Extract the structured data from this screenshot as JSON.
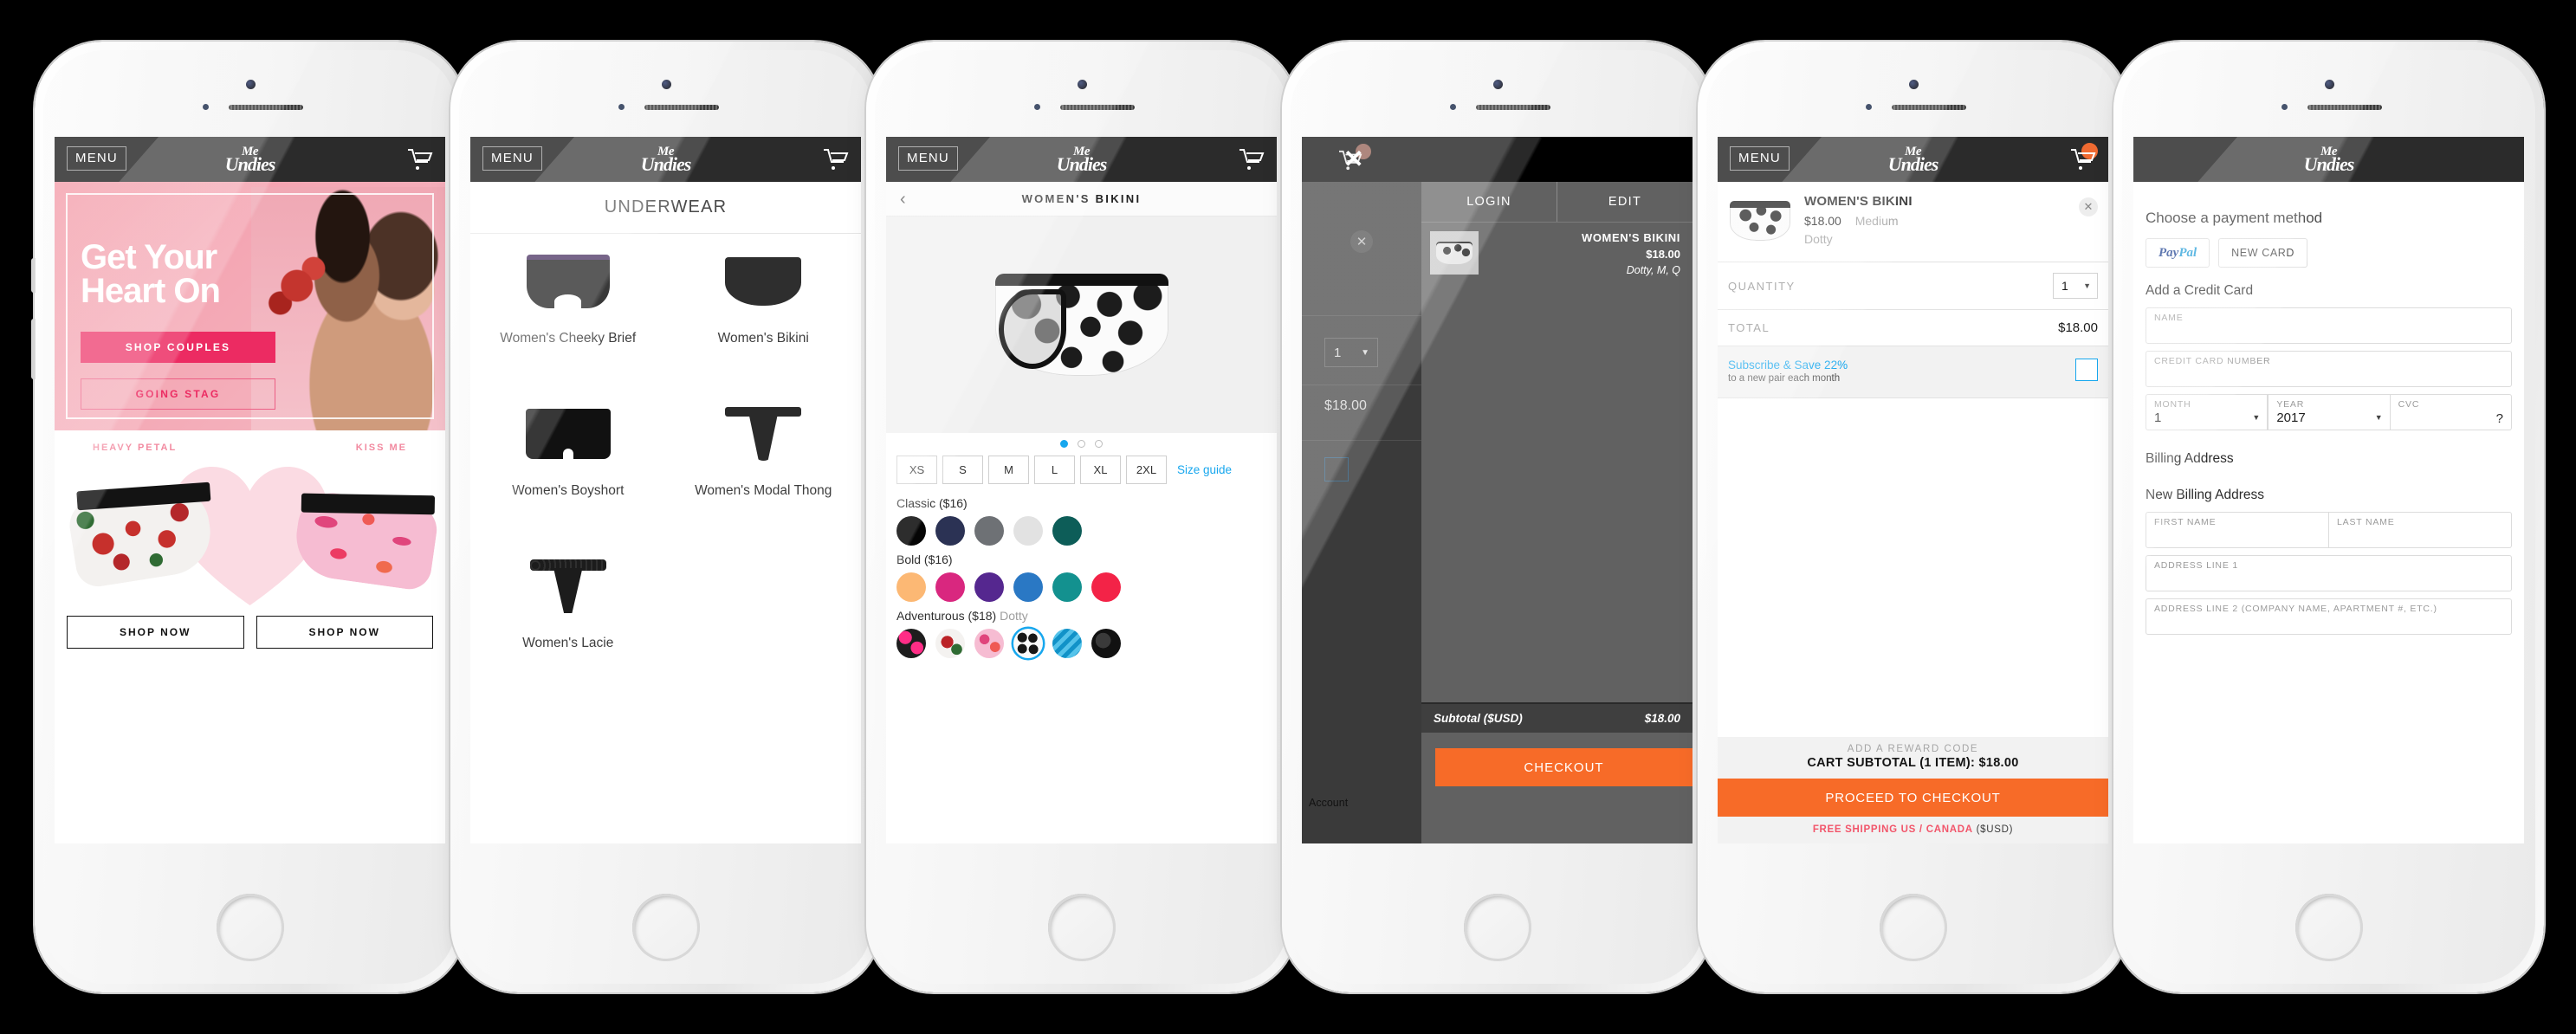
{
  "brand": {
    "logo_line1": "Me",
    "logo_line2": "Undies"
  },
  "common": {
    "menu_label": "MENU",
    "cart_icon": "shopping-cart-icon"
  },
  "screens": [
    {
      "id": "home",
      "hero": {
        "headline_line1": "Get Your",
        "headline_line2": "Heart On",
        "primary_button": "SHOP COUPLES",
        "secondary_button": "GOING STAG"
      },
      "promo": {
        "left_label": "HEAVY PETAL",
        "right_label": "KISS ME",
        "left_button": "SHOP NOW",
        "right_button": "SHOP NOW"
      }
    },
    {
      "id": "category",
      "title": "UNDERWEAR",
      "products": [
        {
          "name": "Women's Cheeky Brief",
          "art": "cheeky-brief"
        },
        {
          "name": "Women's Bikini",
          "art": "bikini"
        },
        {
          "name": "Women's Boyshort",
          "art": "boyshort"
        },
        {
          "name": "Women's Modal Thong",
          "art": "thong"
        },
        {
          "name": "Women's Lacie",
          "art": "lacie"
        }
      ]
    },
    {
      "id": "product",
      "title": "WOMEN'S BIKINI",
      "back_icon": "chevron-left-icon",
      "carousel": {
        "total": 3,
        "active": 1
      },
      "sizes": [
        "XS",
        "S",
        "M",
        "L",
        "XL",
        "2XL"
      ],
      "size_guide": "Size guide",
      "color_groups": [
        {
          "label": "Classic ($16)",
          "selected_name": "",
          "swatches": [
            "#050505",
            "#2b3254",
            "#6e7175",
            "#e2e2e2",
            "#0d5d58"
          ]
        },
        {
          "label": "Bold ($16)",
          "selected_name": "",
          "swatches": [
            "#fcb874",
            "#d9277f",
            "#55278f",
            "#2a78c4",
            "#13918f",
            "#f32347"
          ]
        },
        {
          "label": "Adventurous ($18)",
          "selected_name": "Dotty",
          "swatches": [
            "#e82a7a",
            "#bb2327",
            "#f3a7c4",
            "#f7f7f7",
            "#1192c8",
            "#1c1c1c"
          ],
          "selected_index": 3
        }
      ]
    },
    {
      "id": "cart-overlay",
      "close_icon": "close-icon",
      "tabs": [
        "LOGIN",
        "EDIT"
      ],
      "item": {
        "name": "WOMEN'S BIKINI",
        "price": "$18.00",
        "variant": "Dotty, M, Q"
      },
      "quantity": "1",
      "line_price": "$18.00",
      "subtotal_label": "Subtotal ($USD)",
      "subtotal_value": "$18.00",
      "checkout_button": "CHECKOUT",
      "account_label": "Account"
    },
    {
      "id": "cart",
      "item": {
        "name": "WOMEN'S BIKINI",
        "price": "$18.00",
        "size": "Medium",
        "color": "Dotty",
        "remove_icon": "close-icon"
      },
      "quantity_label": "QUANTITY",
      "quantity_value": "1",
      "total_label": "TOTAL",
      "total_value": "$18.00",
      "subscribe": {
        "title": "Subscribe & Save 22%",
        "subtitle": "to a new pair each month",
        "checked": false
      },
      "reward_code": "ADD A REWARD CODE",
      "cart_subtotal": "CART SUBTOTAL (1 ITEM): $18.00",
      "proceed_button": "PROCEED TO CHECKOUT",
      "shipping_highlight": "FREE SHIPPING US / CANADA",
      "shipping_currency": "($USD)"
    },
    {
      "id": "payment",
      "heading": "Choose a payment method",
      "paypal_label": "PayPal",
      "new_card_label": "NEW CARD",
      "credit_heading": "Add a Credit Card",
      "fields": {
        "name": "NAME",
        "credit_card_number": "CREDIT CARD NUMBER",
        "month_label": "MONTH",
        "month_value": "1",
        "year_label": "YEAR",
        "year_value": "2017",
        "cvc_label": "CVC",
        "cvc_help": "?"
      },
      "billing_heading": "Billing Address",
      "new_billing_heading": "New Billing Address",
      "billing_fields": {
        "first_name": "FIRST NAME",
        "last_name": "LAST NAME",
        "address1": "ADDRESS LINE 1",
        "address2": "ADDRESS LINE 2 (COMPANY NAME, APARTMENT #, ETC.)"
      }
    }
  ],
  "colors": {
    "accent_orange": "#f76b28",
    "accent_blue": "#17a7ee",
    "hero_pink": "#ec2b62",
    "shipping_pink": "#f2556a",
    "header_dark": "#2b2b2b"
  }
}
